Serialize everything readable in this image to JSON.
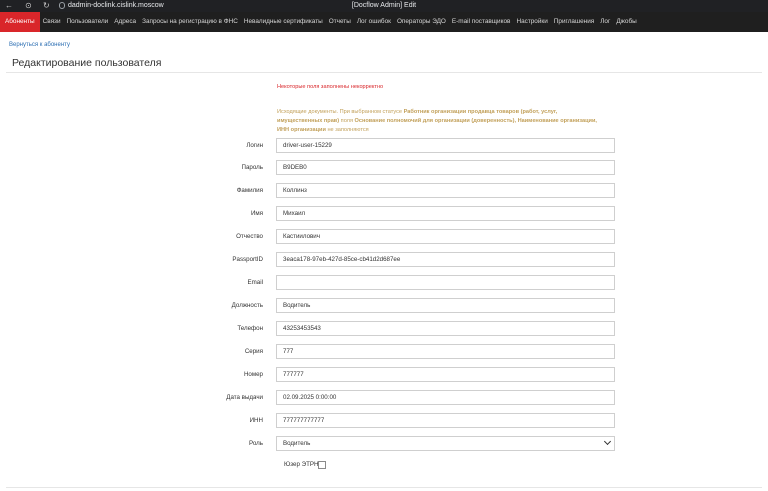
{
  "browser": {
    "url": "dadmin-doclink.cislink.moscow",
    "title": "[Docflow Admin] Edit"
  },
  "menu": [
    {
      "label": "Абоненты",
      "active": true
    },
    {
      "label": "Связи"
    },
    {
      "label": "Пользователи"
    },
    {
      "label": "Адреса"
    },
    {
      "label": "Запросы на регистрацию в ФНС"
    },
    {
      "label": "Невалидные сертификаты"
    },
    {
      "label": "Отчеты"
    },
    {
      "label": "Лог ошибок"
    },
    {
      "label": "Операторы ЭДО"
    },
    {
      "label": "E-mail поставщиков"
    },
    {
      "label": "Настройки"
    },
    {
      "label": "Приглашения"
    },
    {
      "label": "Лог"
    },
    {
      "label": "Джобы"
    }
  ],
  "page": {
    "back_link": "Вернуться к абоненту",
    "title": "Редактирование пользователя",
    "error": "Некоторые поля заполнены некорректно",
    "note": {
      "p1": "Исходящие документы. При выбранном статусе ",
      "b1": "Работник организации продавца товаров (работ, услуг, имущественных прав)",
      "p2": " поля ",
      "b2": "Основание полномочий для организации (доверенность), Наименование организации, ИНН организации",
      "p3": " не заполняются"
    }
  },
  "form": {
    "login": {
      "label": "Логин",
      "value": "driver-user-15229"
    },
    "password": {
      "label": "Пароль",
      "value": "B9DEB0"
    },
    "last_name": {
      "label": "Фамилия",
      "value": "Коллинз"
    },
    "first_name": {
      "label": "Имя",
      "value": "Михаил"
    },
    "patronymic": {
      "label": "Отчество",
      "value": "Кастиилович"
    },
    "passport_id": {
      "label": "PassportID",
      "value": "3eaca178-97eb-427d-85ce-cb41d2d687ee"
    },
    "email": {
      "label": "Email",
      "value": ""
    },
    "position": {
      "label": "Должность",
      "value": "Водитель"
    },
    "phone": {
      "label": "Телефон",
      "value": "43253453543"
    },
    "series": {
      "label": "Серия",
      "value": "777"
    },
    "number": {
      "label": "Номер",
      "value": "777777"
    },
    "issue_date": {
      "label": "Дата выдачи",
      "value": "02.09.2025 0:00:00"
    },
    "inn": {
      "label": "ИНН",
      "value": "777777777777"
    },
    "role": {
      "label": "Роль",
      "value": "Водитель"
    },
    "etrn_user": {
      "label": "Юзер ЭТРН",
      "checked": false
    }
  }
}
